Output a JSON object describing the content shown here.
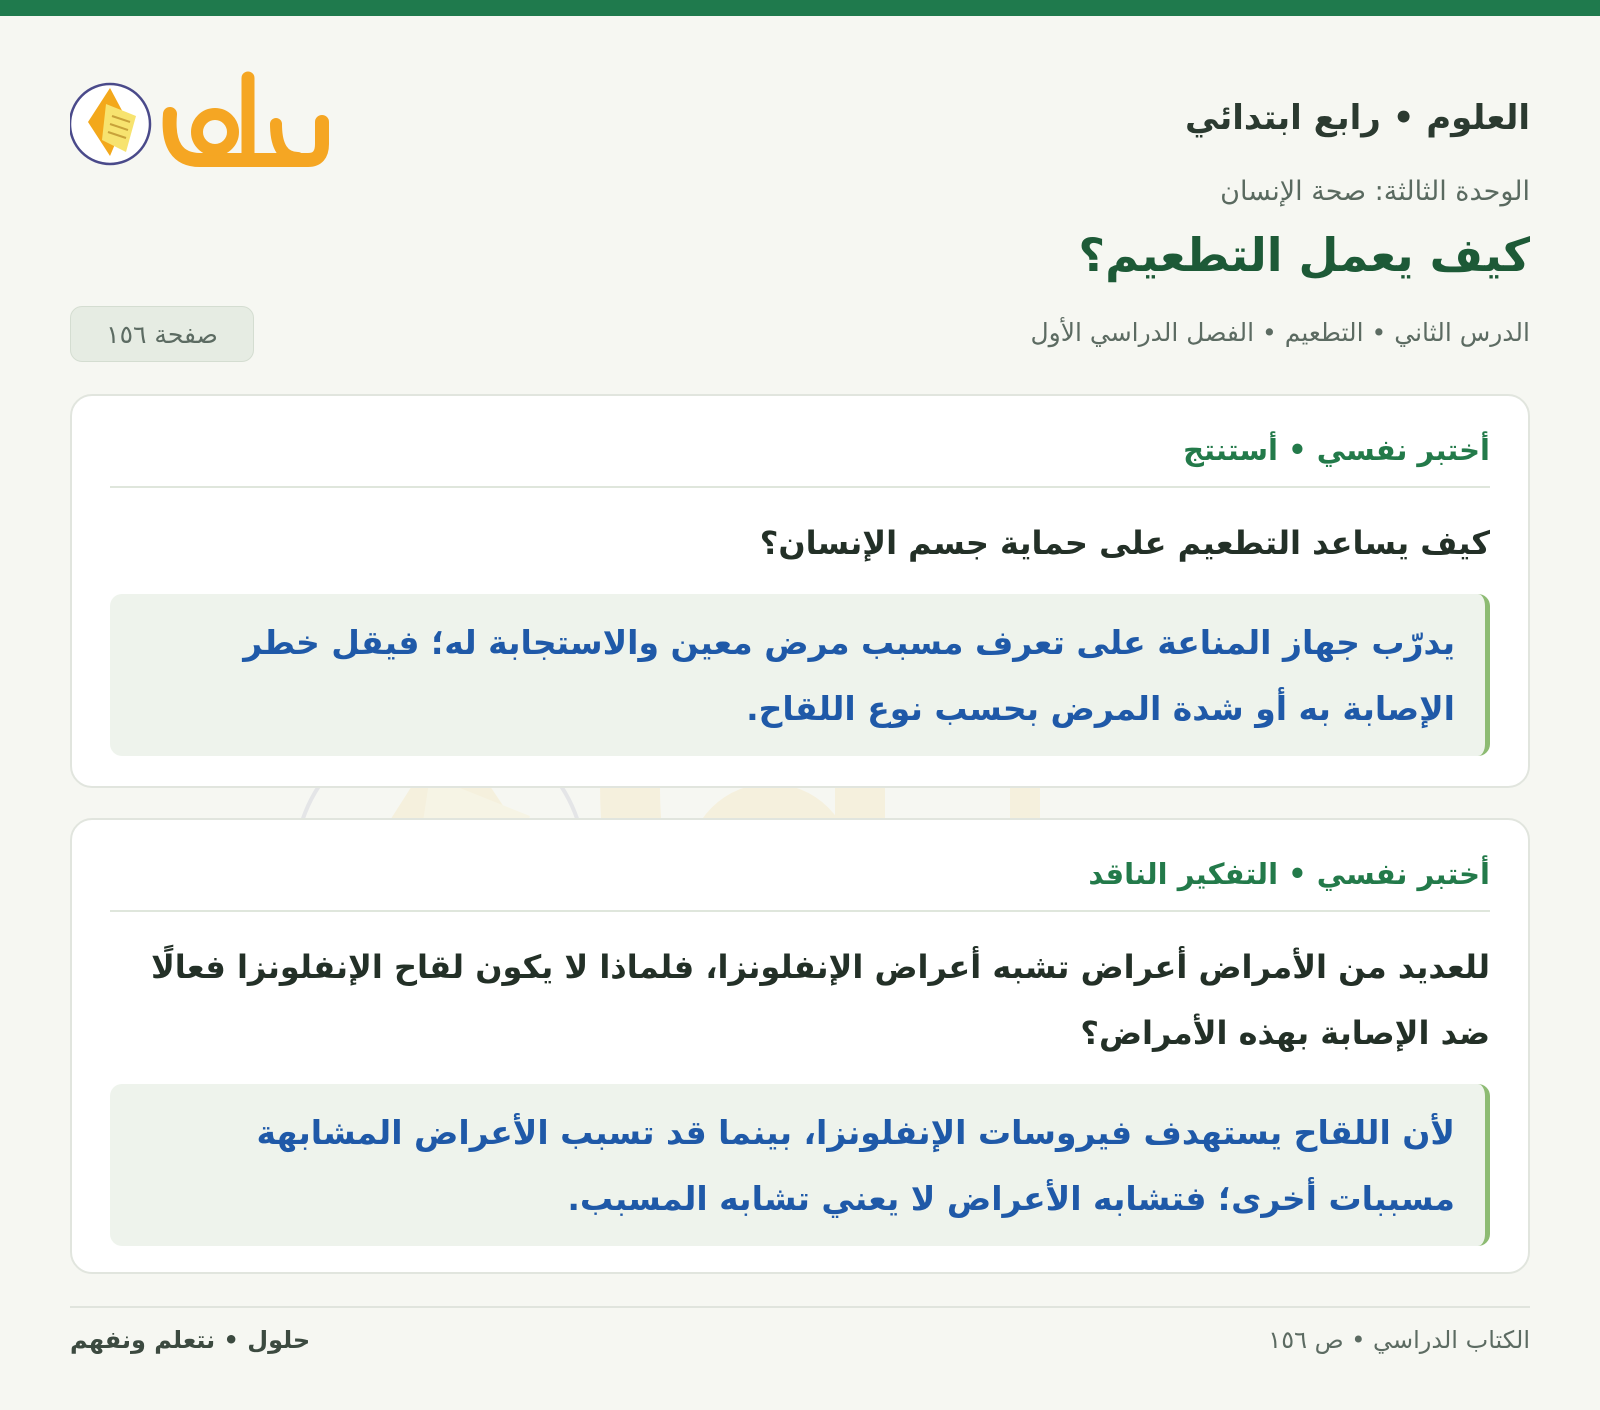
{
  "header": {
    "subject": "العلوم • رابع ابتدائي",
    "logo_text": "حلول"
  },
  "lesson": {
    "unit": "الوحدة الثالثة: صحة الإنسان",
    "title": "كيف يعمل التطعيم؟",
    "meta": "الدرس الثاني • التطعيم • الفصل الدراسي الأول",
    "page_badge": "صفحة ١٥٦"
  },
  "cards": [
    {
      "label": "أختبر نفسي • أستنتج",
      "question": "كيف يساعد التطعيم على حماية جسم الإنسان؟",
      "answer": "يدرّب جهاز المناعة على تعرف مسبب مرض معين والاستجابة له؛ فيقل خطر الإصابة به أو شدة المرض بحسب نوع اللقاح."
    },
    {
      "label": "أختبر نفسي • التفكير الناقد",
      "question": "للعديد من الأمراض أعراض تشبه أعراض الإنفلونزا، فلماذا لا يكون لقاح الإنفلونزا فعالًا ضد الإصابة بهذه الأمراض؟",
      "answer": "لأن اللقاح يستهدف فيروسات الإنفلونزا، بينما قد تسبب الأعراض المشابهة مسببات أخرى؛ فتشابه الأعراض لا يعني تشابه المسبب."
    }
  ],
  "footer": {
    "book_ref": "الكتاب الدراسي • ص ١٥٦",
    "brand": "حلول • نتعلم ونفهم"
  },
  "colors": {
    "brand_green": "#1f7a4d",
    "answer_blue": "#1f59a8",
    "logo_gold": "#f5b21b"
  }
}
